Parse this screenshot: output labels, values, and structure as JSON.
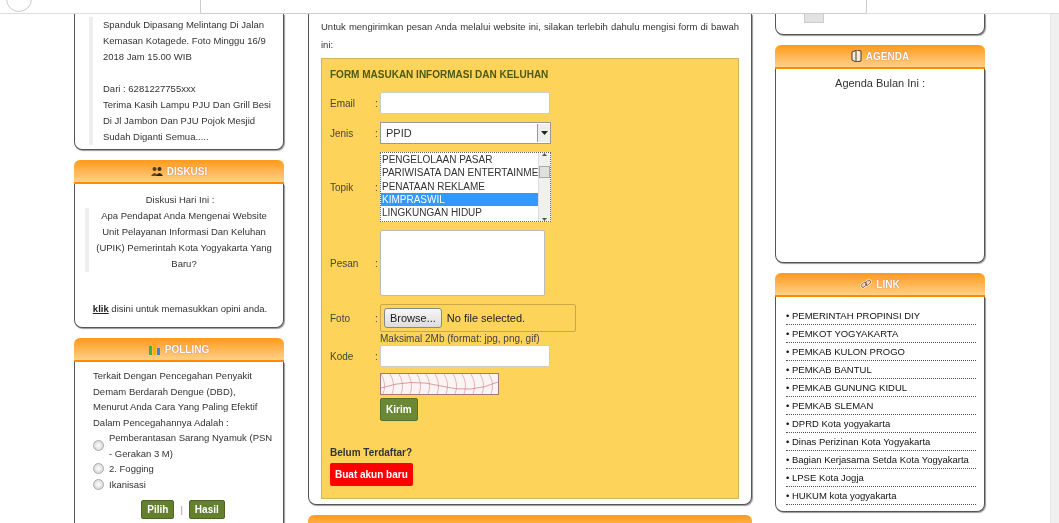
{
  "news_box": {
    "paragraphs": [
      "Spanduk Dipasang Melintang Di Jalan Kemasan Kotagede. Foto Minggu 16/9 2018 Jam 15.00 WIB",
      "Dari : 6281227755xxx\nTerima Kasih Lampu PJU Dan Grill Besi Di Jl Jambon Dan PJU Pojok Mesjid Sudah Diganti Semua....."
    ]
  },
  "discussion": {
    "title": "DISKUSI",
    "heading": "Diskusi Hari Ini :",
    "question": "Apa Pendapat Anda Mengenai Website Unit Pelayanan Informasi Dan Keluhan (UPIK) Pemerintah Kota Yogyakarta Yang Baru?",
    "link": "klik",
    "link_note": "disini untuk memasukkan opini anda."
  },
  "polling": {
    "title": "POLLING",
    "question": "Terkait Dengan Pencegahan Penyakit Demam Berdarah Dengue (DBD), Menurut Anda Cara Yang Paling Efektif Dalam Pencegahannya Adalah :",
    "options": [
      {
        "label": "Pemberantasan Sarang Nyamuk (PSN - Gerakan 3 M)",
        "selected": false
      },
      {
        "label": "2. Fogging",
        "selected": false
      },
      {
        "label": "Ikanisasi",
        "selected": false
      }
    ],
    "buttons": [
      "Pilih",
      "Hasil"
    ],
    "separator": "|"
  },
  "form": {
    "intro": "Untuk mengirimkan pesan Anda melalui website ini, silakan terlebih dahulu mengisi form di bawah ini:",
    "title": "FORM MASUKAN INFORMASI DAN KELUHAN",
    "colon": ":",
    "email": {
      "label": "Email"
    },
    "jenis": {
      "label": "Jenis",
      "value": "PPID"
    },
    "topik": {
      "label": "Topik",
      "options": [
        {
          "label": "PENGELOLAAN PASAR",
          "selected": false
        },
        {
          "label": "PARIWISATA DAN ENTERTAINME",
          "selected": false
        },
        {
          "label": "PENATAAN REKLAME",
          "selected": false
        },
        {
          "label": "KIMPRASWIL",
          "selected": true
        },
        {
          "label": "LINGKUNGAN HIDUP",
          "selected": false
        }
      ]
    },
    "pesan": {
      "label": "Pesan"
    },
    "foto": {
      "label": "Foto",
      "button": "Browse...",
      "status": "No file selected.",
      "hint": "Maksimal 2Mb (format: jpg, png, gif)"
    },
    "kode": {
      "label": "Kode"
    },
    "submit": "Kirim",
    "register_prompt": "Belum Terdaftar?",
    "register_button": "Buat akun baru"
  },
  "agenda": {
    "title": "AGENDA",
    "heading": "Agenda Bulan Ini :"
  },
  "links": {
    "title": "LINK",
    "items": [
      "• PEMERINTAH PROPINSI DIY",
      "• PEMKOT YOGYAKARTA",
      "• PEMKAB KULON PROGO",
      "• PEMKAB BANTUL",
      "• PEMKAB GUNUNG KIDUL",
      "• PEMKAB SLEMAN",
      "• DPRD Kota yogyakarta",
      "• Dinas Perizinan Kota Yogyakarta",
      "• Bagian Kerjasama Setda Kota Yogyakarta",
      "• LPSE Kota Jogja",
      "• HUKUM kota yogyakarta"
    ]
  }
}
